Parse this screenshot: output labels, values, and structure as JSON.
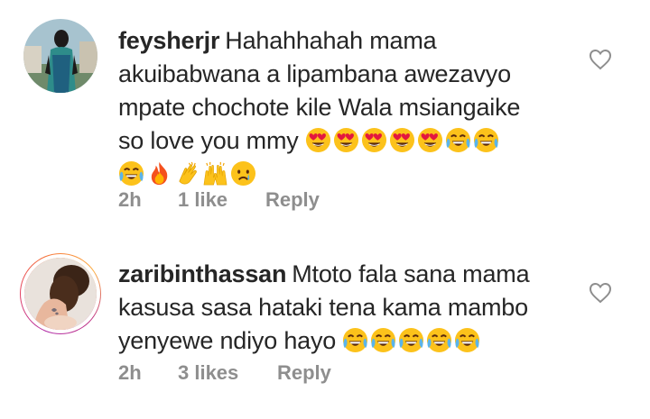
{
  "comments": [
    {
      "username": "feysherjr",
      "text_lines": [
        "Hahahhahah mama",
        "akuibabwana a lipambana awezavyo",
        "mpate chochote kile Wala msiangaike",
        "so love you  mmy"
      ],
      "emojis_line4": [
        "heart-eyes-icon",
        "heart-eyes-icon",
        "heart-eyes-icon",
        "heart-eyes-icon",
        "heart-eyes-icon",
        "tears-of-joy-icon",
        "tears-of-joy-icon"
      ],
      "emojis_line5": [
        "tears-of-joy-icon",
        "fire-icon",
        "clapping-hands-icon",
        "raising-hands-icon",
        "crying-face-icon"
      ],
      "time": "2h",
      "likes": "1 like",
      "reply": "Reply",
      "has_story_ring": false
    },
    {
      "username": "zaribinthassan",
      "text_lines": [
        "Mtoto fala sana mama",
        "kasusa sasa hataki tena kama mambo",
        "yenyewe ndiyo hayo"
      ],
      "emojis_line3": [
        "tears-of-joy-icon",
        "tears-of-joy-icon",
        "tears-of-joy-icon",
        "tears-of-joy-icon",
        "tears-of-joy-icon"
      ],
      "time": "2h",
      "likes": "3 likes",
      "reply": "Reply",
      "has_story_ring": true
    }
  ],
  "colors": {
    "text": "#262626",
    "meta": "#8e8e8e",
    "story_ring": [
      "#b22fa8",
      "#e4405f",
      "#f77737",
      "#fcaf45"
    ]
  }
}
